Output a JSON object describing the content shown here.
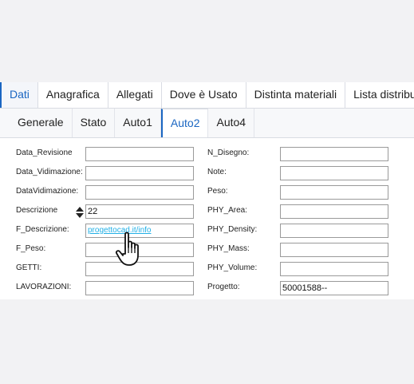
{
  "main_tabs": [
    "Dati",
    "Anagrafica",
    "Allegati",
    "Dove è Usato",
    "Distinta materiali",
    "Lista distribuz"
  ],
  "sub_tabs": [
    "Generale",
    "Stato",
    "Auto1",
    "Auto2",
    "Auto4"
  ],
  "active_main_tab": "Dati",
  "active_sub_tab": "Auto2",
  "left_fields": [
    {
      "label": "Data_Revisione",
      "value": ""
    },
    {
      "label": "Data_Vidimazione:",
      "value": ""
    },
    {
      "label": "DataVidimazione:",
      "value": ""
    },
    {
      "label": "Descrizione",
      "value": "22"
    },
    {
      "label": "F_Descrizione:",
      "value": "progettocad.it/info"
    },
    {
      "label": "F_Peso:",
      "value": ""
    },
    {
      "label": "GETTI:",
      "value": ""
    },
    {
      "label": "LAVORAZIONI:",
      "value": ""
    }
  ],
  "right_fields": [
    {
      "label": "N_Disegno:",
      "value": ""
    },
    {
      "label": "Note:",
      "value": ""
    },
    {
      "label": "Peso:",
      "value": ""
    },
    {
      "label": "PHY_Area:",
      "value": ""
    },
    {
      "label": "PHY_Density:",
      "value": ""
    },
    {
      "label": "PHY_Mass:",
      "value": ""
    },
    {
      "label": "PHY_Volume:",
      "value": ""
    },
    {
      "label": "Progetto:",
      "value": "50001588--"
    }
  ],
  "colors": {
    "accent": "#1a66c2",
    "link": "#22b0e6"
  }
}
